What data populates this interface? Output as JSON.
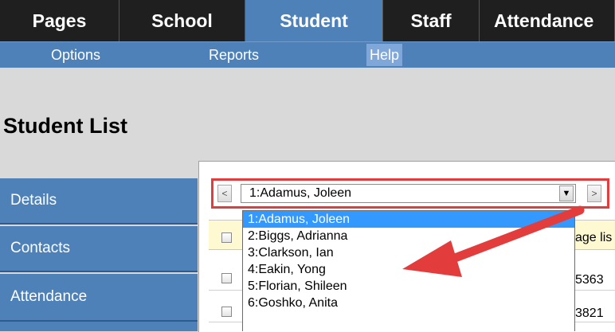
{
  "top_nav": [
    "Pages",
    "School",
    "Student",
    "Staff",
    "Attendance"
  ],
  "sub_nav": {
    "options": "Options",
    "reports": "Reports",
    "help": "Help"
  },
  "page_title": "Student List",
  "sidebar": [
    "Details",
    "Contacts",
    "Attendance"
  ],
  "student_select": {
    "prev": "<",
    "next": ">",
    "selected": "1:Adamus, Joleen",
    "options": [
      "1:Adamus, Joleen",
      "2:Biggs, Adrianna",
      "3:Clarkson, Ian",
      "4:Eakin, Yong",
      "5:Florian, Shileen",
      "6:Goshko, Anita"
    ]
  },
  "header_text": "age lis",
  "rows": [
    "5363",
    "3821"
  ],
  "colors": {
    "nav_dark": "#1f1f1f",
    "nav_blue": "#4f81b9",
    "highlight": "#3399ff",
    "callout": "#e23c3c"
  }
}
